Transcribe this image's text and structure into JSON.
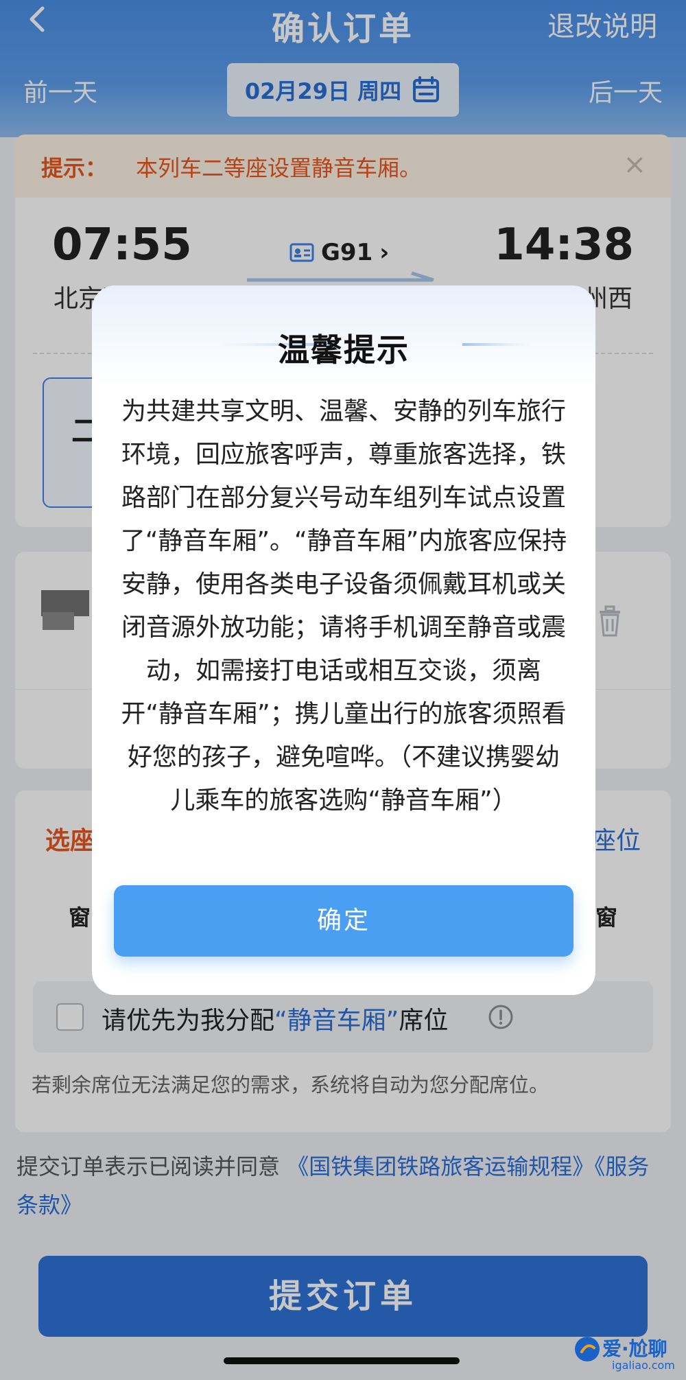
{
  "header": {
    "title": "确认订单",
    "refund_link": "退改说明",
    "prev_day": "前一天",
    "next_day": "后一天",
    "date": "02月29日 周四"
  },
  "notice": {
    "label": "提示：",
    "text": "本列车二等座设置静音车厢。",
    "close": "×"
  },
  "train": {
    "departure_time": "07:55",
    "departure_station": "北京西",
    "arrival_time": "14:38",
    "arrival_station": "兰州西",
    "train_number": "G91",
    "chevron": "›",
    "seat_tab_text": "二"
  },
  "seat_selection": {
    "label": "选座",
    "link": "座位",
    "window_left": "窗",
    "window_right": "窗",
    "quiet_option_prefix": "请优先为我分配",
    "quiet_option_highlight": "“静音车厢”",
    "quiet_option_suffix": "席位",
    "note": "若剩余席位无法满足您的需求，系统将自动为您分配席位。"
  },
  "agreement": {
    "prefix": "提交订单表示已阅读并同意",
    "link1": "《国铁集团铁路旅客运输规程》",
    "link2": "《服务条款》"
  },
  "submit_label": "提交订单",
  "watermark": {
    "text": "爱·尬聊",
    "sub": "igaliao.com"
  },
  "dialog": {
    "title": "温馨提示",
    "body": "为共建共享文明、温馨、安静的列车旅行环境，回应旅客呼声，尊重旅客选择，铁路部门在部分复兴号动车组列车试点设置了“静音车厢”。“静音车厢”内旅客应保持安静，使用各类电子设备须佩戴耳机或关闭音源外放功能；请将手机调至静音或震动，如需接打电话或相互交谈，须离开“静音车厢”；携儿童出行的旅客须照看好您的孩子，避免喧哗。（不建议携婴幼儿乘车的旅客选购“静音车厢”）",
    "confirm_label": "确定"
  },
  "colors": {
    "header_blue": "#4a8fe6",
    "accent_orange": "#e8561e",
    "link_blue": "#2a6fd8",
    "confirm_blue": "#4b9ff3",
    "submit_blue": "#2e72d6"
  },
  "icons": [
    "back-icon",
    "calendar-icon",
    "close-icon",
    "id-card-icon",
    "arrow-icon",
    "trash-icon",
    "info-icon"
  ]
}
